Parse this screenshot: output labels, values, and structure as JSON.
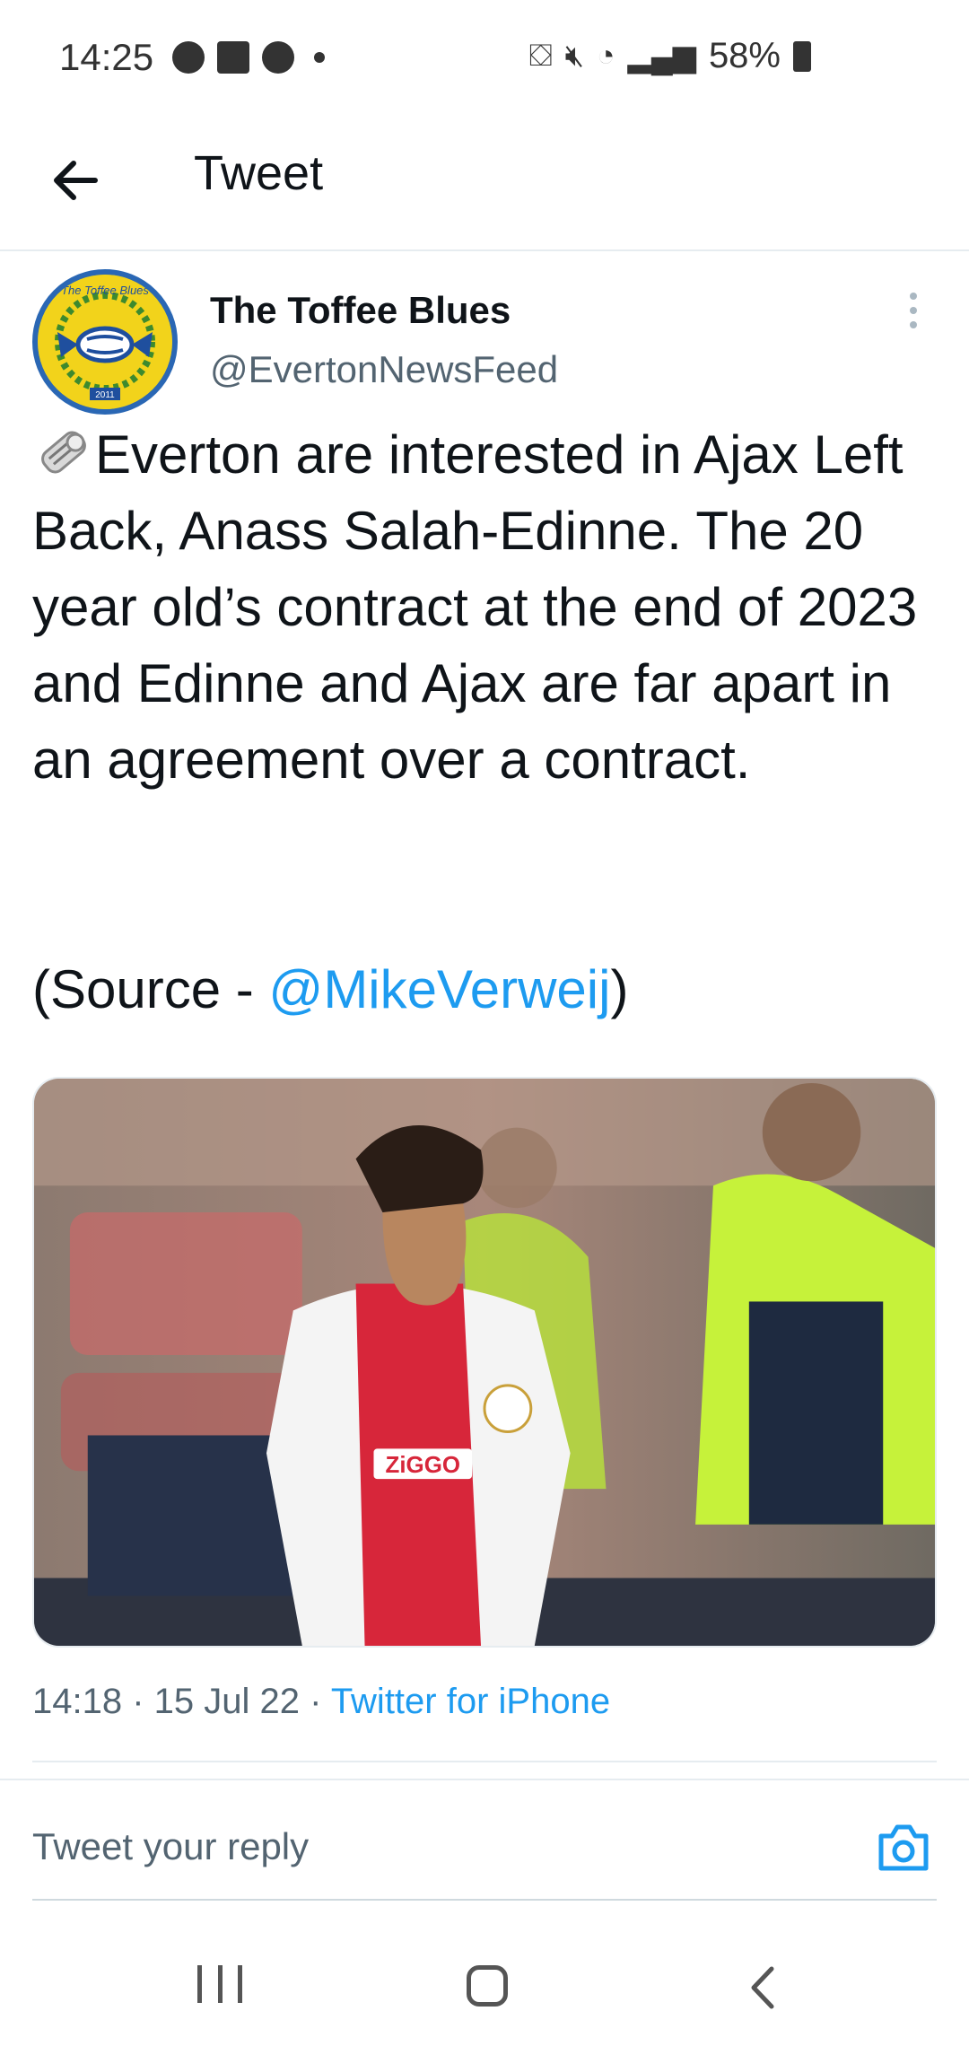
{
  "status_bar": {
    "time": "14:25",
    "battery": "58%",
    "icons_left": [
      "soccer-ball-icon",
      "app-icon",
      "soccer-ball-icon",
      "dot-icon"
    ],
    "icons_right": [
      "recycle-icon",
      "mute-icon",
      "wifi-icon",
      "signal-icon",
      "battery-icon"
    ]
  },
  "header": {
    "title": "Tweet"
  },
  "tweet": {
    "author_name": "The Toffee Blues",
    "author_handle": "@EvertonNewsFeed",
    "avatar_text_top": "The Toffee Blues",
    "avatar_text_bottom": "2011",
    "text": "Everton are interested in Ajax Left Back, Anass Salah-Edinne. The 20 year old’s contract at the end of 2023 and Edinne and Ajax are far apart in an agreement over a contract.",
    "source_prefix": "(Source - ",
    "source_mention": "@MikeVerweij",
    "source_suffix": ")",
    "image_sponsor_text": "ZiGGO",
    "timestamp": "14:18 · 15 Jul 22 · ",
    "client": "Twitter for iPhone"
  },
  "reply": {
    "placeholder": "Tweet your reply"
  },
  "colors": {
    "link": "#1d9bf0",
    "text": "#0f1419",
    "muted": "#536471",
    "divider": "#e6ecf0"
  }
}
